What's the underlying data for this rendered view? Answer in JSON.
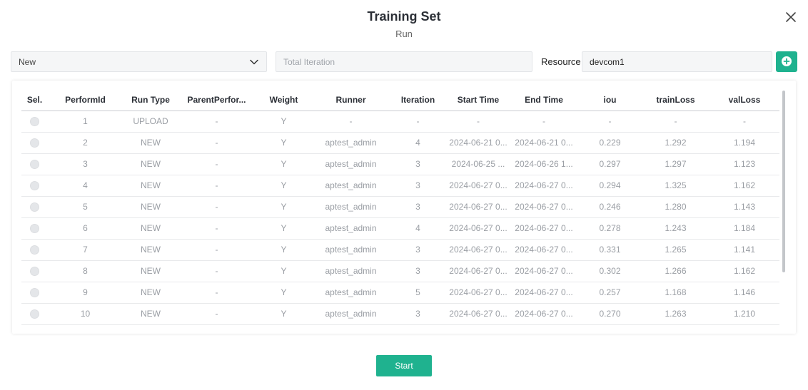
{
  "dialog": {
    "title": "Training Set",
    "subtitle": "Run"
  },
  "icons": {
    "close": "close-icon",
    "chevron": "chevron-down-icon",
    "add": "plus-circle-icon"
  },
  "colors": {
    "accent": "#1fb28f"
  },
  "form": {
    "type_select_value": "New",
    "iteration_placeholder": "Total Iteration",
    "iteration_value": "",
    "resource_label": "Resource",
    "resource_value": "devcom1"
  },
  "table": {
    "headers": [
      "Sel.",
      "PerformId",
      "Run Type",
      "ParentPerfor...",
      "Weight",
      "Runner",
      "Iteration",
      "Start Time",
      "End Time",
      "iou",
      "trainLoss",
      "valLoss"
    ],
    "rows": [
      [
        "1",
        "UPLOAD",
        "-",
        "Y",
        "-",
        "-",
        "-",
        "-",
        "-",
        "-",
        "-"
      ],
      [
        "2",
        "NEW",
        "-",
        "Y",
        "aptest_admin",
        "4",
        "2024-06-21 0...",
        "2024-06-21 0...",
        "0.229",
        "1.292",
        "1.194"
      ],
      [
        "3",
        "NEW",
        "-",
        "Y",
        "aptest_admin",
        "3",
        "2024-06-25 ...",
        "2024-06-26 1...",
        "0.297",
        "1.297",
        "1.123"
      ],
      [
        "4",
        "NEW",
        "-",
        "Y",
        "aptest_admin",
        "3",
        "2024-06-27 0...",
        "2024-06-27 0...",
        "0.294",
        "1.325",
        "1.162"
      ],
      [
        "5",
        "NEW",
        "-",
        "Y",
        "aptest_admin",
        "3",
        "2024-06-27 0...",
        "2024-06-27 0...",
        "0.246",
        "1.280",
        "1.143"
      ],
      [
        "6",
        "NEW",
        "-",
        "Y",
        "aptest_admin",
        "4",
        "2024-06-27 0...",
        "2024-06-27 0...",
        "0.278",
        "1.243",
        "1.184"
      ],
      [
        "7",
        "NEW",
        "-",
        "Y",
        "aptest_admin",
        "3",
        "2024-06-27 0...",
        "2024-06-27 0...",
        "0.331",
        "1.265",
        "1.141"
      ],
      [
        "8",
        "NEW",
        "-",
        "Y",
        "aptest_admin",
        "3",
        "2024-06-27 0...",
        "2024-06-27 0...",
        "0.302",
        "1.266",
        "1.162"
      ],
      [
        "9",
        "NEW",
        "-",
        "Y",
        "aptest_admin",
        "5",
        "2024-06-27 0...",
        "2024-06-27 0...",
        "0.257",
        "1.168",
        "1.146"
      ],
      [
        "10",
        "NEW",
        "-",
        "Y",
        "aptest_admin",
        "3",
        "2024-06-27 0...",
        "2024-06-27 0...",
        "0.270",
        "1.263",
        "1.210"
      ]
    ]
  },
  "actions": {
    "start_label": "Start"
  }
}
